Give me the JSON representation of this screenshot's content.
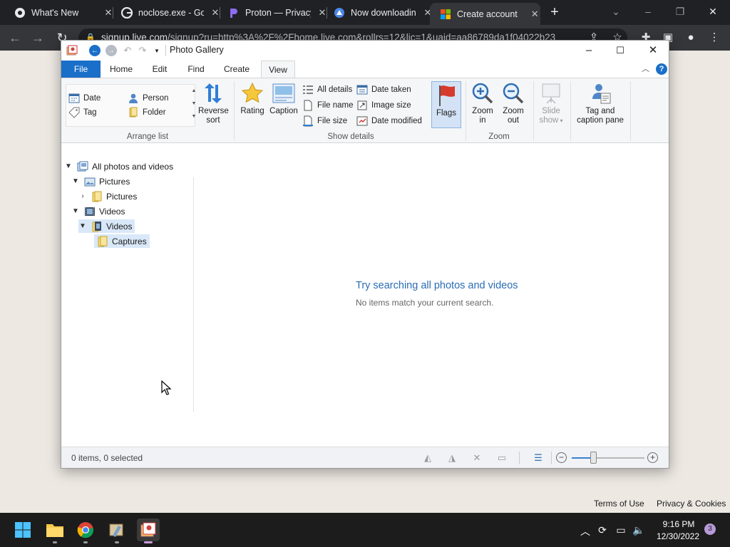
{
  "browser": {
    "tabs": [
      {
        "title": "What's New",
        "icon": "chrome-icon"
      },
      {
        "title": "noclose.exe - Go",
        "icon": "google-icon"
      },
      {
        "title": "Proton — Privacy",
        "icon": "proton-icon"
      },
      {
        "title": "Now downloading",
        "icon": "drive-icon"
      },
      {
        "title": "Create account",
        "icon": "microsoft-icon",
        "active": true
      }
    ],
    "new_tab": "+",
    "url_domain": "signup.live.com",
    "url_path": "/signup?ru=http%3A%2F%2Fhome.live.com&rollrs=12&lic=1&uaid=aa86789da1f04022b23"
  },
  "page": {
    "terms": "Terms of Use",
    "privacy": "Privacy & Cookies"
  },
  "gallery": {
    "title": "Photo Gallery",
    "tabs": [
      "File",
      "Home",
      "Edit",
      "Find",
      "Create",
      "View"
    ],
    "active_tab": "View",
    "help": "?",
    "arrange": {
      "items": [
        "Date",
        "Person",
        "Tag",
        "Folder"
      ],
      "reverse_sort": "Reverse sort",
      "label": "Arrange list"
    },
    "show_details": {
      "rating": "Rating",
      "caption": "Caption",
      "all_details": "All details",
      "file_name": "File name",
      "file_size": "File size",
      "date_taken": "Date taken",
      "image_size": "Image size",
      "date_modified": "Date modified",
      "flags": "Flags",
      "label": "Show details"
    },
    "zoom": {
      "zoom_in": "Zoom in",
      "zoom_out": "Zoom out",
      "label": "Zoom"
    },
    "slide_show": "Slide show",
    "tag_caption": "Tag and caption pane",
    "tree": [
      {
        "label": "All photos and videos"
      },
      {
        "label": "Pictures"
      },
      {
        "label": "Pictures"
      },
      {
        "label": "Videos"
      },
      {
        "label": "Videos"
      },
      {
        "label": "Captures"
      }
    ],
    "empty_title": "Try searching all photos and videos",
    "empty_sub": "No items match your current search.",
    "status": "0 items, 0 selected",
    "zoom_level": 0.3
  },
  "taskbar": {
    "time": "9:16 PM",
    "date": "12/30/2022",
    "notifications": "3"
  },
  "colors": {
    "accent": "#1a6fc9",
    "selection": "#d9e8f8",
    "link": "#2a6cb4"
  }
}
